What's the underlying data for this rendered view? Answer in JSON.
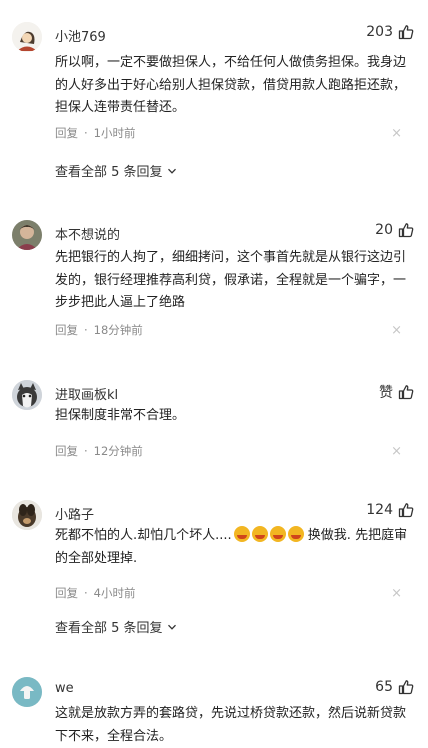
{
  "comments": [
    {
      "username": "小池769",
      "likes": "203",
      "text": "所以啊，一定不要做担保人，不给任何人做债务担保。我身边的人好多出于好心给别人担保贷款，借贷用款人跑路拒还款，担保人连带责任替还。",
      "reply_label": "回复",
      "time": "1小时前",
      "view_replies": "查看全部 5 条回复"
    },
    {
      "username": "本不想说的",
      "likes": "20",
      "text": "先把银行的人拘了，细细拷问，这个事首先就是从银行这边引发的，银行经理推荐高利贷，假承诺，全程就是一个骗字，一步步把此人逼上了绝路",
      "reply_label": "回复",
      "time": "18分钟前"
    },
    {
      "username": "进取画板kl",
      "likes": "赞",
      "text": "担保制度非常不合理。",
      "reply_label": "回复",
      "time": "12分钟前"
    },
    {
      "username": "小路子",
      "likes": "124",
      "text_part1": "死都不怕的人.却怕几个坏人....",
      "emoji_name": "crying-face-emoji",
      "text_part2": " 换做我. 先把庭审的全部处理掉.",
      "reply_label": "回复",
      "time": "4小时前",
      "view_replies": "查看全部 5 条回复"
    },
    {
      "username": "we",
      "likes": "65",
      "text": "这就是放款方弄的套路贷，先说过桥贷款还款，然后说新贷款下不来，全程合法。"
    }
  ],
  "icons": {
    "like": "thumbs-up-icon",
    "dismiss": "close-icon",
    "expand": "chevron-down-icon"
  },
  "close_glyph": "×",
  "dot": "·"
}
